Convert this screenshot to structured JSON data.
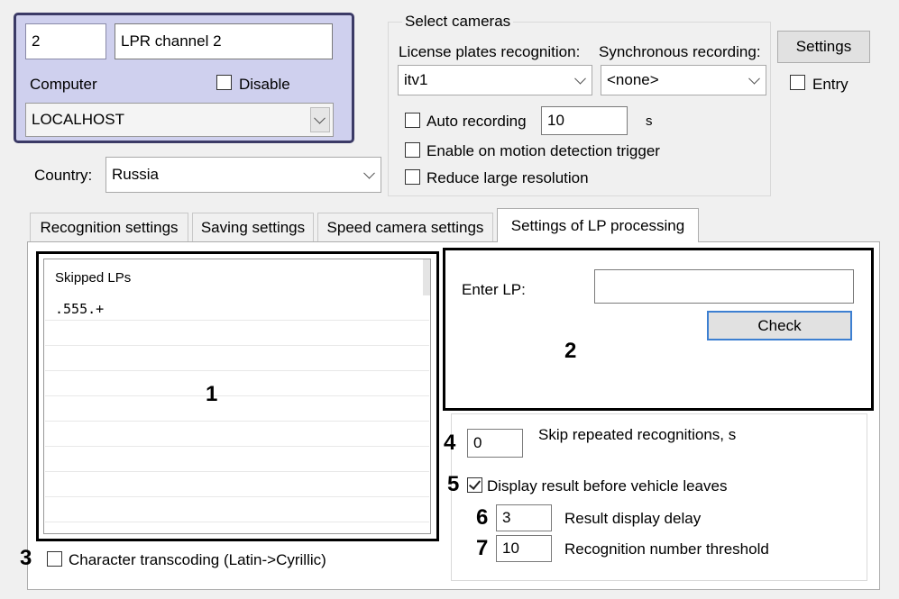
{
  "channel": {
    "id": "2",
    "name": "LPR channel 2"
  },
  "computer": {
    "label": "Computer",
    "value": "LOCALHOST",
    "disable_label": "Disable",
    "disable_checked": false
  },
  "country": {
    "label": "Country:",
    "value": "Russia"
  },
  "select_cameras": {
    "title": "Select cameras",
    "lpr_label": "License plates recognition:",
    "lpr_value": "itv1",
    "sync_label": "Synchronous recording:",
    "sync_value": "<none>",
    "auto_recording_label": "Auto recording",
    "auto_recording_value": "10",
    "auto_recording_unit": "s",
    "auto_recording_checked": false,
    "motion_label": "Enable on motion detection trigger",
    "motion_checked": false,
    "reduce_label": "Reduce large resolution",
    "reduce_checked": false
  },
  "settings_button": "Settings",
  "entry": {
    "label": "Entry",
    "checked": false
  },
  "tabs": [
    {
      "label": "Recognition settings",
      "active": false
    },
    {
      "label": "Saving settings",
      "active": false
    },
    {
      "label": "Speed camera settings",
      "active": false
    },
    {
      "label": "Settings of LP processing",
      "active": true
    }
  ],
  "skipped_lps": {
    "header": "Skipped LPs",
    "items": [
      ".555.+"
    ]
  },
  "check_panel": {
    "enter_label": "Enter LP:",
    "enter_value": "",
    "check_button": "Check"
  },
  "skip_repeated": {
    "value": "0",
    "label": "Skip repeated recognitions, s"
  },
  "display_result": {
    "label": "Display result before vehicle leaves",
    "checked": true
  },
  "result_delay": {
    "value": "3",
    "label": "Result display delay"
  },
  "recognition_threshold": {
    "value": "10",
    "label": "Recognition number threshold"
  },
  "transcoding": {
    "label": "Character transcoding (Latin->Cyrillic)",
    "checked": false
  },
  "callouts": {
    "c1": "1",
    "c2": "2",
    "c3": "3",
    "c4": "4",
    "c5": "5",
    "c6": "6",
    "c7": "7"
  },
  "colors": {
    "highlight_border": "#000000",
    "group_panel": "#cfd0ee",
    "group_border": "#3b3a66",
    "button_focus": "#3c7fd1"
  }
}
